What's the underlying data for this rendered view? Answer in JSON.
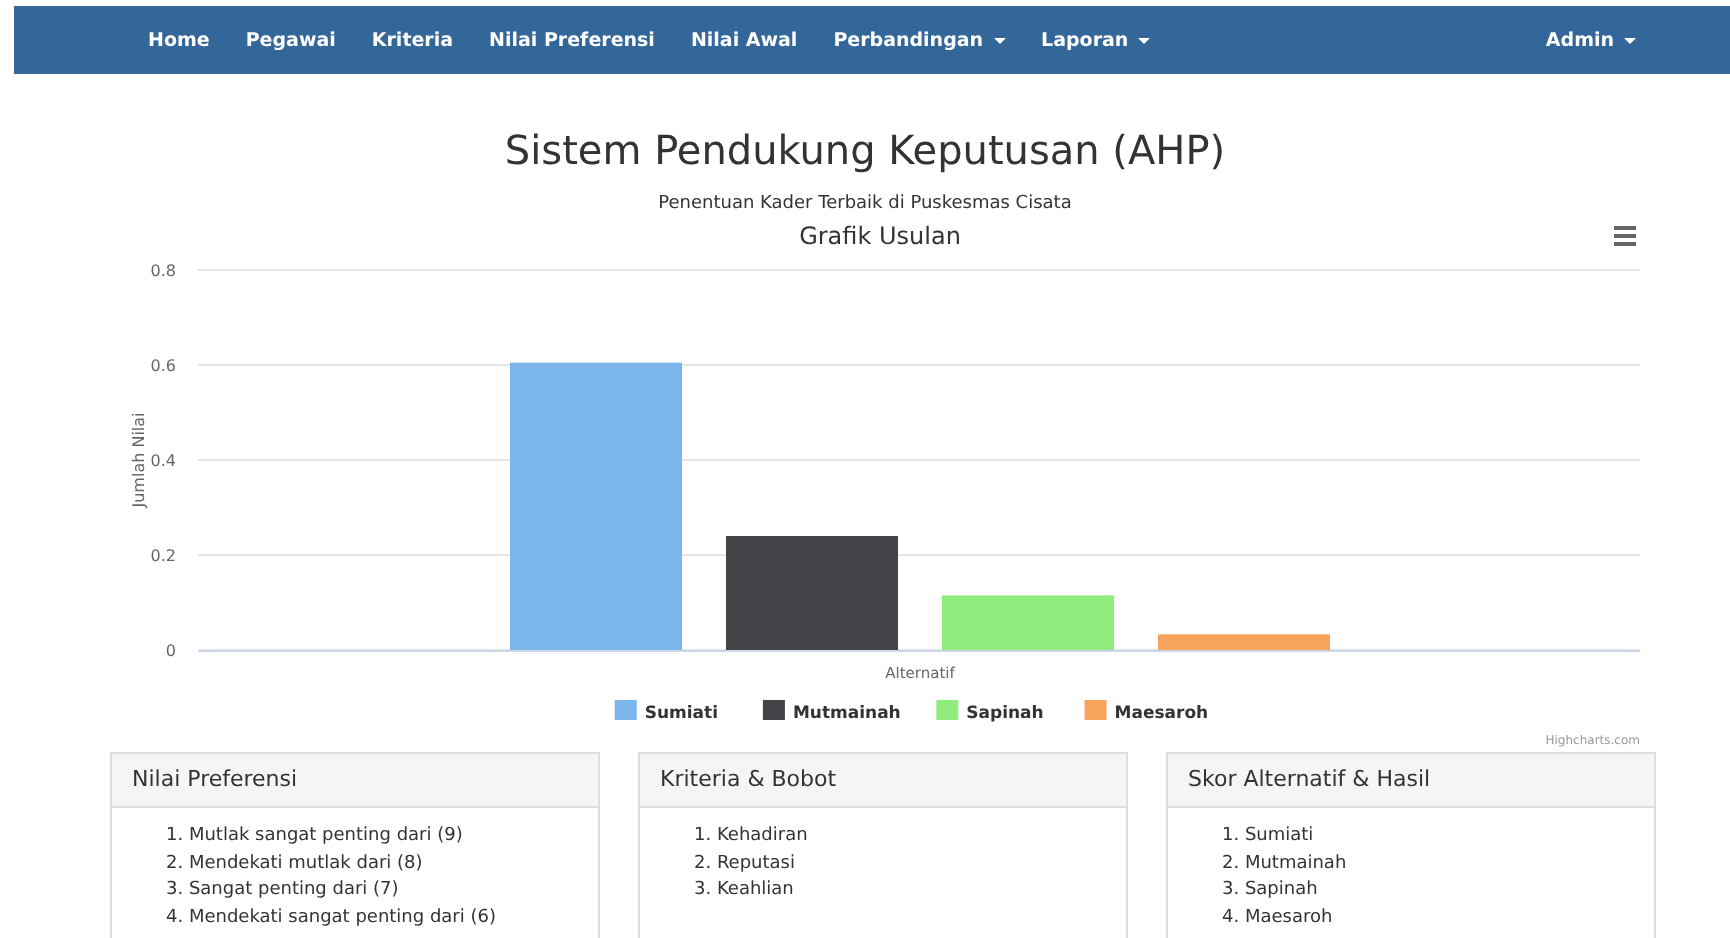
{
  "navbar": {
    "items": [
      {
        "label": "Home",
        "dropdown": false
      },
      {
        "label": "Pegawai",
        "dropdown": false
      },
      {
        "label": "Kriteria",
        "dropdown": false
      },
      {
        "label": "Nilai Preferensi",
        "dropdown": false
      },
      {
        "label": "Nilai Awal",
        "dropdown": false
      },
      {
        "label": "Perbandingan",
        "dropdown": true
      },
      {
        "label": "Laporan",
        "dropdown": true
      }
    ],
    "user": {
      "label": "Admin",
      "dropdown": true
    }
  },
  "title": "Sistem Pendukung Keputusan (AHP)",
  "subtitle": "Penentuan Kader Terbaik di Puskesmas Cisata",
  "chart": {
    "credits": "Highcharts.com",
    "chart_data": {
      "type": "bar",
      "grid": true,
      "legend": "bottom",
      "title": "Grafik Usulan",
      "xlabel": "Alternatif",
      "ylabel": "Jumlah Nilai",
      "ylim": [
        0,
        0.8
      ],
      "yticks": [
        0,
        0.2,
        0.4,
        0.6,
        0.8
      ],
      "series": [
        {
          "name": "Sumiati",
          "color": "#7cb5ec",
          "values": [
            0.605
          ]
        },
        {
          "name": "Mutmainah",
          "color": "#434348",
          "values": [
            0.24
          ]
        },
        {
          "name": "Sapinah",
          "color": "#90ed7d",
          "values": [
            0.115
          ]
        },
        {
          "name": "Maesaroh",
          "color": "#f7a35c",
          "values": [
            0.033
          ]
        }
      ]
    }
  },
  "panels": [
    {
      "title": "Nilai Preferensi",
      "items": [
        "1. Mutlak sangat penting dari (9)",
        "2. Mendekati mutlak dari (8)",
        "3. Sangat penting dari (7)",
        "4. Mendekati sangat penting dari (6)"
      ]
    },
    {
      "title": "Kriteria & Bobot",
      "items": [
        "1. Kehadiran",
        "2. Reputasi",
        "3. Keahlian"
      ]
    },
    {
      "title": "Skor Alternatif & Hasil",
      "items": [
        "1. Sumiati",
        "2. Mutmainah",
        "3. Sapinah",
        "4. Maesaroh"
      ]
    }
  ]
}
